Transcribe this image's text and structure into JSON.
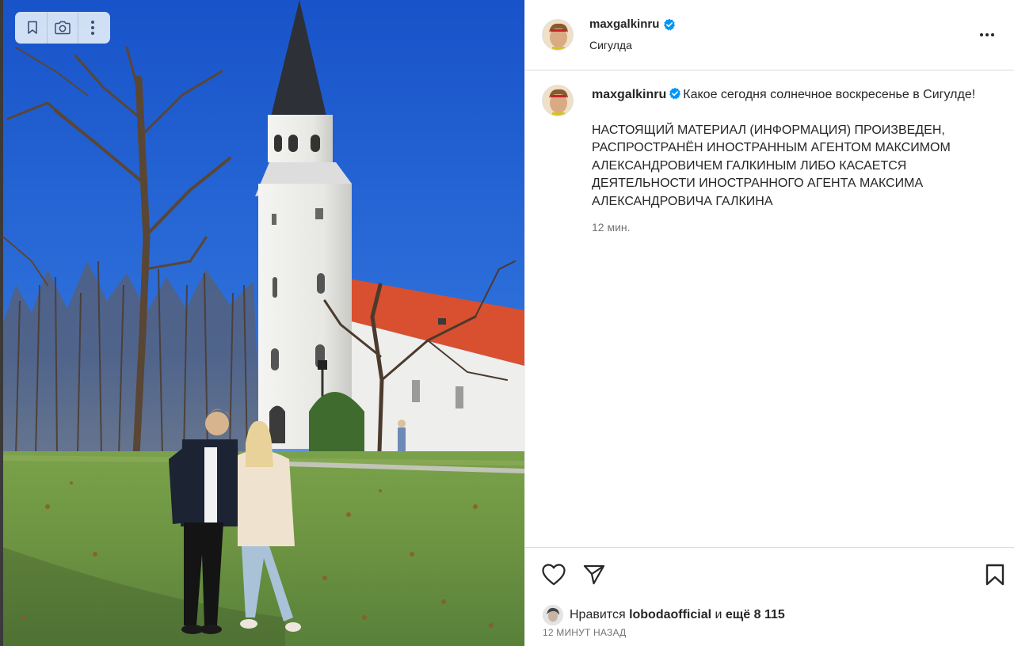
{
  "post": {
    "username": "maxgalkinru",
    "location": "Сигулда",
    "caption_line1": "Какое сегодня солнечное воскресенье в Сигулде!",
    "caption_line2": "НАСТОЯЩИЙ МАТЕРИАЛ (ИНФОРМАЦИЯ) ПРОИЗВЕДЕН, РАСПРОСТРАНЁН ИНОСТРАННЫМ АГЕНТОМ МАКСИМОМ АЛЕКСАНДРОВИЧЕМ ГАЛКИНЫМ ЛИБО КАСАЕТСЯ ДЕЯТЕЛЬНОСТИ ИНОСТРАННОГО АГЕНТА МАКСИМА АЛЕКСАНДРОВИЧА ГАЛКИНА",
    "caption_time": "12 мин.",
    "likes_prefix": "Нравится",
    "liked_by": "lobodaofficial",
    "likes_and": "и",
    "likes_more": "ещё 8 115",
    "posted_ago": "12 МИНУТ НАЗАД"
  },
  "icons": {
    "image_toolbar": [
      "bookmark-icon",
      "camera-search-icon",
      "more-vertical-icon"
    ],
    "header": [
      "verified-badge-icon",
      "more-horizontal-icon"
    ],
    "actions": [
      "heart-icon",
      "share-icon",
      "save-icon"
    ]
  },
  "colors": {
    "verified": "#0095f6",
    "text": "#262626",
    "secondary": "#737373",
    "divider": "#dbdbdb",
    "sky": "#1f5fd1",
    "roof": "#d8502f"
  }
}
